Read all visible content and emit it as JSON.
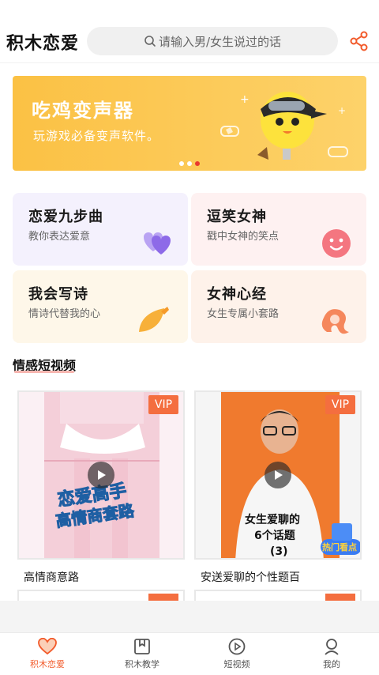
{
  "header": {
    "app_title": "积木恋爱",
    "search_placeholder": "请输入男/女生说过的话"
  },
  "banner": {
    "title": "吃鸡变声器",
    "subtitle": "玩游戏必备变声软件。",
    "slides": 3,
    "active_slide": 3
  },
  "cards": [
    {
      "title": "恋爱九步曲",
      "subtitle": "教你表达爱意",
      "icon": "hearts-icon",
      "bg": "#f4f1fd"
    },
    {
      "title": "逗笑女神",
      "subtitle": "戳中女神的笑点",
      "icon": "smiley-icon",
      "bg": "#fef1f1"
    },
    {
      "title": "我会写诗",
      "subtitle": "情诗代替我的心",
      "icon": "leaf-icon",
      "bg": "#fef7e9"
    },
    {
      "title": "女神心经",
      "subtitle": "女生专属小套路",
      "icon": "woman-icon",
      "bg": "#fef2ea"
    }
  ],
  "section": {
    "title": "情感短视频"
  },
  "videos": [
    {
      "caption": "高情商意路",
      "badge": "VIP",
      "overlay_text_1": "恋爱高手",
      "overlay_text_2": "高情商套路"
    },
    {
      "caption": "安送爱聊的个性题百",
      "badge": "VIP",
      "overlay_text_1": "女生爱聊的",
      "overlay_text_2": "6个话题",
      "overlay_text_3": "(3)",
      "sticker": "热门看点"
    }
  ],
  "tabbar": [
    {
      "label": "积木恋爱",
      "icon": "heart-icon",
      "active": true
    },
    {
      "label": "积木教学",
      "icon": "bookmark-icon",
      "active": false
    },
    {
      "label": "短视频",
      "icon": "play-circle-icon",
      "active": false
    },
    {
      "label": "我的",
      "icon": "person-icon",
      "active": false
    }
  ],
  "colors": {
    "accent": "#f25a2a",
    "vip": "#f46e3f",
    "banner": "#fbc144"
  }
}
